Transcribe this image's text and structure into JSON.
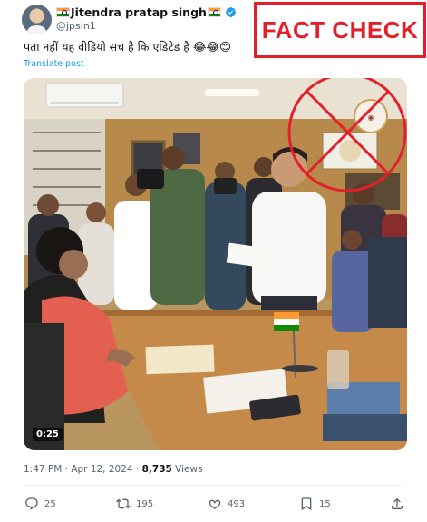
{
  "post": {
    "display_name": "Jitendra pratap singh",
    "handle": "@jpsin1",
    "text": "पता नहीं यह वीडियो सच है कि एडिटेड है 😂😂😊",
    "translate_label": "Translate post",
    "stamp_text": "FACT CHECK",
    "video_duration": "0:25",
    "time": "1:47 PM · Apr 12, 2024 · ",
    "views_count": "8,735",
    "views_label": " Views"
  },
  "actions": {
    "reply_count": "25",
    "repost_count": "195",
    "like_count": "493",
    "bookmark_count": "15"
  },
  "colors": {
    "link": "#1d9bf0",
    "stamp_red": "#e3202a",
    "muted": "#536471"
  },
  "icons": [
    "verified-badge-icon",
    "reply-icon",
    "repost-icon",
    "like-icon",
    "bookmark-icon",
    "share-icon",
    "india-flag-icon"
  ]
}
